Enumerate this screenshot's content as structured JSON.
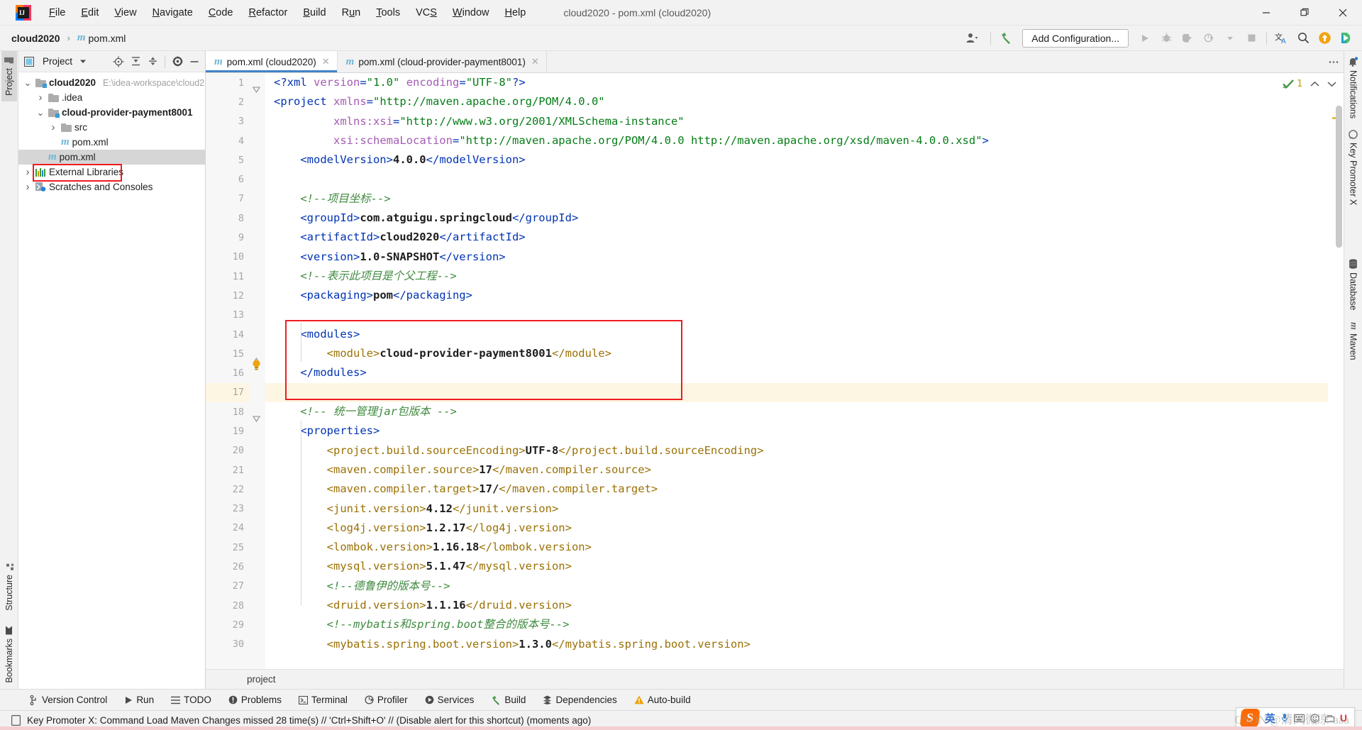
{
  "window": {
    "title": "cloud2020 - pom.xml (cloud2020)",
    "minimize": "—",
    "maximize": "❐",
    "close": "✕"
  },
  "menu": {
    "items": [
      {
        "label": "File",
        "accel": "F"
      },
      {
        "label": "Edit",
        "accel": "E"
      },
      {
        "label": "View",
        "accel": "V"
      },
      {
        "label": "Navigate",
        "accel": "N"
      },
      {
        "label": "Code",
        "accel": "C"
      },
      {
        "label": "Refactor",
        "accel": "R"
      },
      {
        "label": "Build",
        "accel": "B"
      },
      {
        "label": "Run",
        "accel": "u"
      },
      {
        "label": "Tools",
        "accel": "T"
      },
      {
        "label": "VCS",
        "accel": "S"
      },
      {
        "label": "Window",
        "accel": "W"
      },
      {
        "label": "Help",
        "accel": "H"
      }
    ]
  },
  "navbar": {
    "breadcrumb_project": "cloud2020",
    "breadcrumb_separator": "›",
    "breadcrumb_file": "pom.xml",
    "maven_icon_letter": "m",
    "add_configuration": "Add Configuration...",
    "icons": [
      "user-settings-icon",
      "build-hammer-icon",
      "run-icon",
      "debug-icon",
      "run-coverage-icon",
      "profile-icon",
      "dropdown-icon",
      "stop-icon",
      "translate-icon",
      "search-everywhere-icon",
      "update-icon",
      "plugin-icon"
    ]
  },
  "rail_left": {
    "tabs": [
      {
        "label": "Project",
        "icon": "folder-icon",
        "active": true
      },
      {
        "label": "Structure",
        "icon": "structure-icon",
        "active": false
      },
      {
        "label": "Bookmarks",
        "icon": "bookmark-icon",
        "active": false
      }
    ]
  },
  "rail_right": {
    "tabs": [
      {
        "label": "Notifications",
        "icon": "bell-icon"
      },
      {
        "label": "Key Promoter X",
        "icon": "key-promoter-icon"
      },
      {
        "label": "Database",
        "icon": "database-icon"
      },
      {
        "label": "Maven",
        "icon": "maven-m-icon"
      }
    ]
  },
  "project_panel": {
    "title": "Project",
    "dropdown_icon": "chevron-down-icon",
    "toolbar_icons": [
      "locate-icon",
      "expand-all-icon",
      "collapse-all-icon",
      "gear-icon",
      "hide-icon"
    ],
    "tree": [
      {
        "indent": 0,
        "arrow": "v",
        "icon": "module-folder-icon",
        "label": "cloud2020",
        "bold": true,
        "path": "E:\\idea-workspace\\cloud2",
        "selected": false
      },
      {
        "indent": 1,
        "arrow": ">",
        "icon": "folder-icon",
        "label": ".idea",
        "bold": false,
        "path": "",
        "selected": false
      },
      {
        "indent": 1,
        "arrow": "v",
        "icon": "module-folder-icon",
        "label": "cloud-provider-payment8001",
        "bold": true,
        "path": "",
        "selected": false
      },
      {
        "indent": 2,
        "arrow": ">",
        "icon": "folder-icon",
        "label": "src",
        "bold": false,
        "path": "",
        "selected": false
      },
      {
        "indent": 2,
        "arrow": "",
        "icon": "maven-file-icon",
        "label": "pom.xml",
        "bold": false,
        "path": "",
        "selected": false
      },
      {
        "indent": 1,
        "arrow": "",
        "icon": "maven-file-icon",
        "label": "pom.xml",
        "bold": false,
        "path": "",
        "selected": true
      },
      {
        "indent": 0,
        "arrow": ">",
        "icon": "external-libraries-icon",
        "label": "External Libraries",
        "bold": false,
        "path": "",
        "selected": false
      },
      {
        "indent": 0,
        "arrow": ">",
        "icon": "scratches-icon",
        "label": "Scratches and Consoles",
        "bold": false,
        "path": "",
        "selected": false
      }
    ]
  },
  "editor": {
    "tabs": [
      {
        "label": "pom.xml (cloud2020)",
        "icon": "maven-file-icon",
        "active": true,
        "close": "✕"
      },
      {
        "label": "pom.xml (cloud-provider-payment8001)",
        "icon": "maven-file-icon",
        "active": false,
        "close": "✕"
      }
    ],
    "tabs_menu_icon": "more-options-icon",
    "inspection": {
      "status_icon": "inspection-ok-icon",
      "warning_count": "1",
      "prev_icon": "chevron-up-icon",
      "next_icon": "chevron-down-icon"
    },
    "breadcrumb": "project",
    "lines": [
      {
        "n": 1,
        "html": "<span class=\"k-pi\">&lt;?xml </span><span class=\"k-attr\">version</span><span class=\"k-pi\">=</span><span class=\"k-str\">\"1.0\"</span> <span class=\"k-attr\">encoding</span><span class=\"k-pi\">=</span><span class=\"k-str\">\"UTF-8\"</span><span class=\"k-pi\">?&gt;</span>"
      },
      {
        "n": 2,
        "html": "<span class=\"k-tag\">&lt;project </span><span class=\"k-attr\">xmlns</span><span class=\"k-tag\">=</span><span class=\"k-str\">\"http://maven.apache.org/POM/4.0.0\"</span>"
      },
      {
        "n": 3,
        "html": "         <span class=\"k-attr\">xmlns:xsi</span><span class=\"k-tag\">=</span><span class=\"k-str\">\"http://www.w3.org/2001/XMLSchema-instance\"</span>"
      },
      {
        "n": 4,
        "html": "         <span class=\"k-attr\">xsi:schemaLocation</span><span class=\"k-tag\">=</span><span class=\"k-str\">\"http://maven.apache.org/POM/4.0.0 http://maven.apache.org/xsd/maven-4.0.0.xsd\"</span><span class=\"k-tag\">&gt;</span>"
      },
      {
        "n": 5,
        "html": "    <span class=\"k-tag\">&lt;modelVersion&gt;</span><span class=\"k-txt\">4.0.0</span><span class=\"k-tag\">&lt;/modelVersion&gt;</span>"
      },
      {
        "n": 6,
        "html": ""
      },
      {
        "n": 7,
        "html": "    <span class=\"k-cmt\">&lt;!--项目坐标--&gt;</span>"
      },
      {
        "n": 8,
        "html": "    <span class=\"k-tag\">&lt;groupId&gt;</span><span class=\"k-txt\">com.atguigu.springcloud</span><span class=\"k-tag\">&lt;/groupId&gt;</span>"
      },
      {
        "n": 9,
        "html": "    <span class=\"k-tag\">&lt;artifactId&gt;</span><span class=\"k-txt\">cloud2020</span><span class=\"k-tag\">&lt;/artifactId&gt;</span>"
      },
      {
        "n": 10,
        "html": "    <span class=\"k-tag\">&lt;version&gt;</span><span class=\"k-txt\">1.0-SNAPSHOT</span><span class=\"k-tag\">&lt;/version&gt;</span>"
      },
      {
        "n": 11,
        "html": "    <span class=\"k-cmt\">&lt;!--表示此项目是个父工程--&gt;</span>"
      },
      {
        "n": 12,
        "html": "    <span class=\"k-tag\">&lt;packaging&gt;</span><span class=\"k-txt\">pom</span><span class=\"k-tag\">&lt;/packaging&gt;</span>"
      },
      {
        "n": 13,
        "html": ""
      },
      {
        "n": 14,
        "html": "    <span class=\"k-tag\">&lt;modules&gt;</span>"
      },
      {
        "n": 15,
        "html": "        <span class=\"k-tag2\">&lt;module&gt;</span><span class=\"k-txt\">cloud-provider-payment8001</span><span class=\"k-tag2\">&lt;/module&gt;</span>"
      },
      {
        "n": 16,
        "html": "    <span class=\"k-tag\">&lt;/modules&gt;</span>"
      },
      {
        "n": 17,
        "html": "",
        "highlight": true
      },
      {
        "n": 18,
        "html": "    <span class=\"k-cmt\">&lt;!-- 统一管理jar包版本 --&gt;</span>"
      },
      {
        "n": 19,
        "html": "    <span class=\"k-tag\">&lt;properties&gt;</span>"
      },
      {
        "n": 20,
        "html": "        <span class=\"k-tag2\">&lt;project.build.sourceEncoding&gt;</span><span class=\"k-txt\">UTF-8</span><span class=\"k-tag2\">&lt;/project.build.sourceEncoding&gt;</span>"
      },
      {
        "n": 21,
        "html": "        <span class=\"k-tag2\">&lt;maven.compiler.source&gt;</span><span class=\"k-txt\">17</span><span class=\"k-tag2\">&lt;/maven.compiler.source&gt;</span>"
      },
      {
        "n": 22,
        "html": "        <span class=\"k-tag2\">&lt;maven.compiler.target&gt;</span><span class=\"k-txt\">17/</span><span class=\"k-tag2\">&lt;/maven.compiler.target&gt;</span>"
      },
      {
        "n": 23,
        "html": "        <span class=\"k-tag2\">&lt;junit.version&gt;</span><span class=\"k-txt\">4.12</span><span class=\"k-tag2\">&lt;/junit.version&gt;</span>"
      },
      {
        "n": 24,
        "html": "        <span class=\"k-tag2\">&lt;log4j.version&gt;</span><span class=\"k-txt\">1.2.17</span><span class=\"k-tag2\">&lt;/log4j.version&gt;</span>"
      },
      {
        "n": 25,
        "html": "        <span class=\"k-tag2\">&lt;lombok.version&gt;</span><span class=\"k-txt\">1.16.18</span><span class=\"k-tag2\">&lt;/lombok.version&gt;</span>"
      },
      {
        "n": 26,
        "html": "        <span class=\"k-tag2\">&lt;mysql.version&gt;</span><span class=\"k-txt\">5.1.47</span><span class=\"k-tag2\">&lt;/mysql.version&gt;</span>"
      },
      {
        "n": 27,
        "html": "        <span class=\"k-cmt\">&lt;!--德鲁伊的版本号--&gt;</span>"
      },
      {
        "n": 28,
        "html": "        <span class=\"k-tag2\">&lt;druid.version&gt;</span><span class=\"k-txt\">1.1.16</span><span class=\"k-tag2\">&lt;/druid.version&gt;</span>"
      },
      {
        "n": 29,
        "html": "        <span class=\"k-cmt\">&lt;!--mybatis和spring.boot整合的版本号--&gt;</span>"
      },
      {
        "n": 30,
        "html": "        <span class=\"k-tag2\">&lt;mybatis.spring.boot.version&gt;</span><span class=\"k-txt\">1.3.0</span><span class=\"k-tag2\">&lt;/mybatis.spring.boot.version&gt;</span>"
      }
    ]
  },
  "tool_window_bar": {
    "items": [
      {
        "label": "Version Control",
        "icon": "branch-icon"
      },
      {
        "label": "Run",
        "icon": "run-icon"
      },
      {
        "label": "TODO",
        "icon": "todo-icon"
      },
      {
        "label": "Problems",
        "icon": "problems-icon"
      },
      {
        "label": "Terminal",
        "icon": "terminal-icon"
      },
      {
        "label": "Profiler",
        "icon": "profiler-icon"
      },
      {
        "label": "Services",
        "icon": "services-icon"
      },
      {
        "label": "Build",
        "icon": "build-hammer-icon"
      },
      {
        "label": "Dependencies",
        "icon": "dependencies-icon"
      },
      {
        "label": "Auto-build",
        "icon": "warning-triangle-icon"
      }
    ]
  },
  "status_bar": {
    "icon": "event-log-icon",
    "message": "Key Promoter X: Command Load Maven Changes missed 28 time(s) // 'Ctrl+Shift+O' // (Disable alert for this shortcut) (moments ago)"
  },
  "ime": {
    "logo": "S",
    "mode": "英",
    "icons": [
      "mic-icon",
      "keyboard-icon",
      "emoji-icon",
      "toolbox-icon"
    ],
    "u_label": "U"
  },
  "watermark": "CSDN @清风微凉-aaa",
  "colors": {
    "accent_blue": "#4282c8",
    "tag_blue": "#0033b3",
    "tag_gold": "#9b7106",
    "string_green": "#067d17",
    "comment_green": "#3f8a3f",
    "attr_purple": "#a55bb5",
    "highlight_red": "#ef1c21",
    "selection_gray": "#d6d6d6",
    "line_highlight": "#fdf6e3"
  }
}
